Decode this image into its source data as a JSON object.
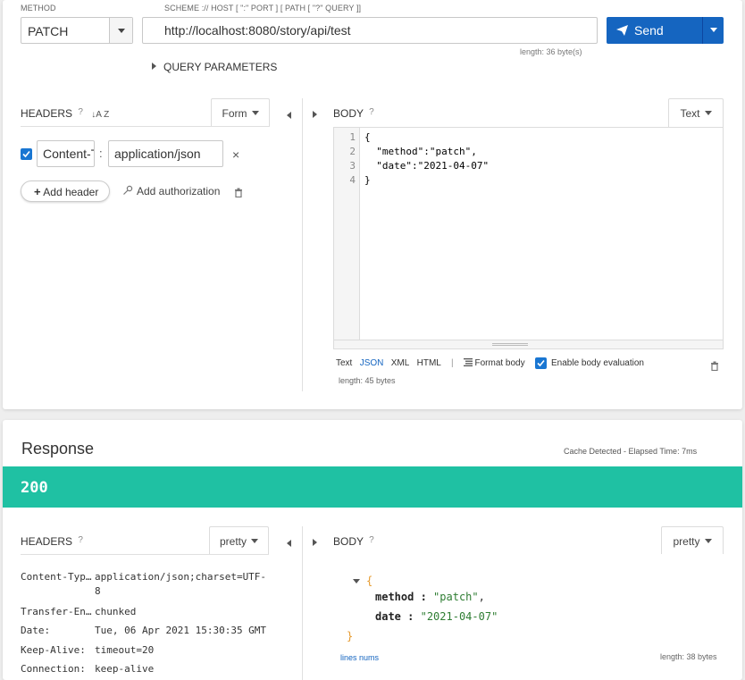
{
  "request": {
    "method_label": "METHOD",
    "method": "PATCH",
    "url_label": "SCHEME :// HOST [ \":\" PORT ] [ PATH [ \"?\" QUERY ]]",
    "url": "http://localhost:8080/story/api/test",
    "url_length": "length: 36 byte(s)",
    "send_label": "Send",
    "query_params_label": "QUERY PARAMETERS",
    "headers": {
      "title": "HEADERS",
      "help": "?",
      "sort_icon": "↓A Z",
      "mode": "Form",
      "items": [
        {
          "checked": true,
          "name": "Content-Type",
          "value": "application/json"
        }
      ],
      "separator": ":",
      "remove_glyph": "×",
      "add_header": "Add header",
      "add_auth": "Add authorization"
    },
    "body": {
      "title": "BODY",
      "help": "?",
      "mode": "Text",
      "line_numbers": [
        "1",
        "2",
        "3",
        "4"
      ],
      "lines": [
        "{",
        "  \"method\":\"patch\",",
        "  \"date\":\"2021-04-07\"",
        "}"
      ],
      "formats": [
        "Text",
        "JSON",
        "XML",
        "HTML"
      ],
      "active_format": "JSON",
      "separator": "|",
      "format_body": "Format body",
      "enable_eval": "Enable body evaluation",
      "length": "length: 45 bytes"
    }
  },
  "response": {
    "title": "Response",
    "cache_info": "Cache Detected - Elapsed Time: 7ms",
    "status": "200",
    "status_color": "#1fc1a3",
    "headers": {
      "title": "HEADERS",
      "help": "?",
      "mode": "pretty",
      "rows": [
        {
          "name": "Content-Typ…",
          "value": "application/json;charset=UTF-",
          "value2": "8"
        },
        {
          "name": "Transfer-En…",
          "value": "chunked"
        },
        {
          "name": "Date:",
          "value": "Tue, 06 Apr 2021 15:30:35 GMT"
        },
        {
          "name": "Keep-Alive:",
          "value": "timeout=20"
        },
        {
          "name": "Connection:",
          "value": "keep-alive"
        }
      ]
    },
    "body": {
      "title": "BODY",
      "help": "?",
      "mode": "pretty",
      "open_brace": "{",
      "close_brace": "}",
      "fields": [
        {
          "key": "method",
          "colon": " : ",
          "value": "\"patch\"",
          "comma": ","
        },
        {
          "key": "date",
          "colon": " : ",
          "value": "\"2021-04-07\"",
          "comma": ""
        }
      ],
      "lines_nums": "lines nums",
      "length": "length: 38 bytes"
    }
  },
  "colors": {
    "accent": "#1565c0",
    "success": "#1fc1a3"
  }
}
